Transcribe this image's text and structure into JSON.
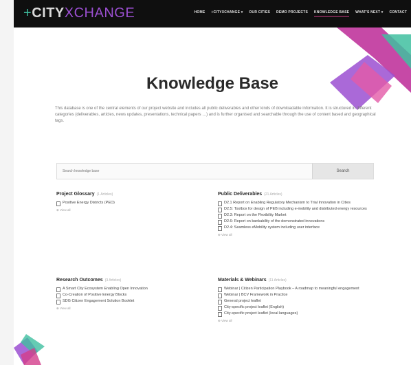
{
  "header": {
    "logo": {
      "plus": "+",
      "city": "CITY",
      "x": "X",
      "change": "CHANGE"
    },
    "nav": [
      {
        "label": "HOME",
        "active": false
      },
      {
        "label": "+CITYXCHANGE ▾",
        "active": false
      },
      {
        "label": "OUR CITIES",
        "active": false
      },
      {
        "label": "DEMO PROJECTS",
        "active": false
      },
      {
        "label": "KNOWLEDGE BASE",
        "active": true
      },
      {
        "label": "WHAT'S NEXT ▾",
        "active": false
      },
      {
        "label": "CONTACT",
        "active": false
      }
    ]
  },
  "page_title": "Knowledge Base",
  "intro": "This database is one of the central elements of our project website and includes all public deliverables and other kinds of downloadable information. It is structured in different categories (deliverables, articles, news updates, presentations, technical papers …) and is further organised and searchable through the use of content based and geographical tags.",
  "search": {
    "placeholder": "Search knowledge base",
    "button": "Search"
  },
  "sections": [
    {
      "title": "Project Glossary",
      "count": "(1 Articles)",
      "items": [
        "Positive Energy Districts (PED)"
      ],
      "view_all": "⊕ View all"
    },
    {
      "title": "Public Deliverables",
      "count": "(21 Articles)",
      "items": [
        "D2.1 Report on Enabling Regulatory Mechanism to Trial Innovation in Cities",
        "D2.5: Toolbox for design of PEB including e-mobility and distributed energy resources",
        "D2.3: Report on the Flexibility Market",
        "D2.6: Report on bankability of the demonstrated innovations",
        "D2.4: Seamless eMobility system including user interface"
      ],
      "view_all": "⊕ View all"
    },
    {
      "title": "Research Outcomes",
      "count": "(3 Articles)",
      "items": [
        "A Smart City Ecosystem Enabling Open Innovation",
        "Co-Creation of Positive Energy Blocks",
        "SDG Citizen Engagement Solution Booklet"
      ],
      "view_all": "⊕ View all"
    },
    {
      "title": "Materials & Webinars",
      "count": "(11 Articles)",
      "items": [
        "Webinar | Citizen Participation Playbook – A roadmap to meaningful engagement",
        "Webinar | BCV Framework in Practice",
        "General project leaflet",
        "City-specific project leaflet (English)",
        "City-specific project leaflet (local languages)"
      ],
      "view_all": "⊕ View all"
    }
  ],
  "colors": {
    "topbar": "#0f0f0f",
    "accent_pink": "#d33d8b",
    "accent_purple": "#9b4fd1",
    "accent_teal": "#3fbfa0"
  }
}
